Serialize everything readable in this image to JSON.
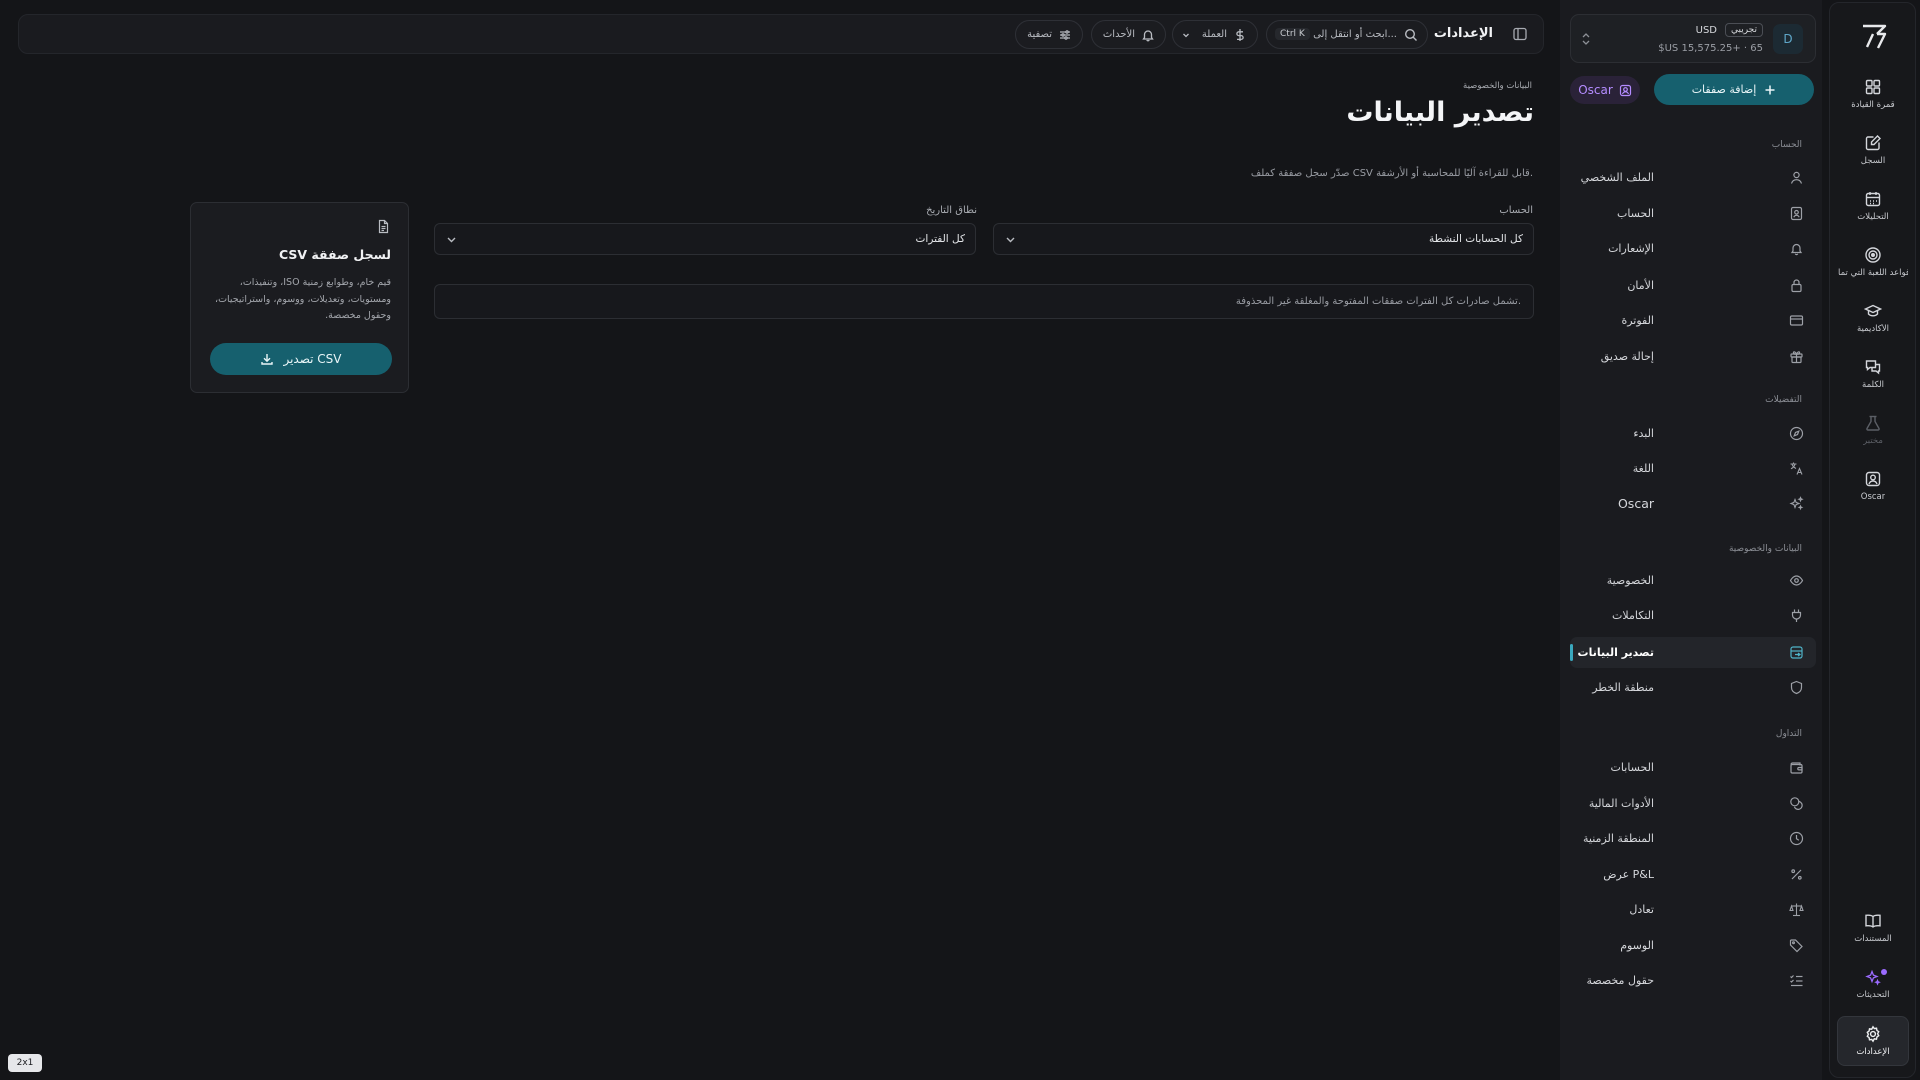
{
  "topbar": {
    "title": "الإعدادات",
    "search_placeholder": "ابحث أو انتقل إلى...",
    "search_shortcut": "Ctrl K",
    "currency_label": "العملة",
    "events_label": "الأحداث",
    "filter_label": "تصفية"
  },
  "page": {
    "breadcrumb": "البيانات والخصوصية",
    "title": "تصدير البيانات",
    "description": "صدّر سجل صفقة كملف CSV قابل للقراءة آليًا للمحاسبة أو الأرشفة.",
    "account_label": "الحساب",
    "account_value": "كل الحسابات النشطة",
    "range_label": "نطاق التاريخ",
    "range_value": "كل الفترات",
    "notice": "تشمل صادرات كل الفترات صفقات المفتوحة والمغلقة غير المحذوفة."
  },
  "card": {
    "title": "CSV لسجل صفقة",
    "description": "قيم خام، وطوابع زمنية ISO، وتنفيذات، ومستويات، وتعديلات، ووسوم، واستراتيجيات، وحقول مخصصة.",
    "button": "تصدير CSV"
  },
  "account_box": {
    "avatar": "D",
    "badge": "تجريبي",
    "currency": "USD",
    "balance": "$US 15,575.25+ · 65"
  },
  "sidebar": {
    "add_trade": "إضافة صفقات",
    "oscar_chip": "Oscar",
    "sections": [
      {
        "title": "الحساب",
        "items": [
          {
            "label": "الملف الشخصي",
            "icon": "user-icon"
          },
          {
            "label": "الحساب",
            "icon": "id-card-icon"
          },
          {
            "label": "الإشعارات",
            "icon": "bell-icon"
          },
          {
            "label": "الأمان",
            "icon": "lock-icon"
          },
          {
            "label": "الفوترة",
            "icon": "credit-card-icon"
          },
          {
            "label": "إحالة صديق",
            "icon": "gift-icon"
          }
        ]
      },
      {
        "title": "التفضيلات",
        "items": [
          {
            "label": "البدء",
            "icon": "compass-icon"
          },
          {
            "label": "اللغة",
            "icon": "translate-icon"
          },
          {
            "label": "Oscar",
            "icon": "sparkles-icon"
          }
        ]
      },
      {
        "title": "البيانات والخصوصية",
        "items": [
          {
            "label": "الخصوصية",
            "icon": "eye-icon"
          },
          {
            "label": "التكاملات",
            "icon": "plug-icon"
          },
          {
            "label": "تصدير البيانات",
            "icon": "database-export-icon"
          },
          {
            "label": "منطقة الخطر",
            "icon": "shield-icon"
          }
        ]
      },
      {
        "title": "التداول",
        "items": [
          {
            "label": "الحسابات",
            "icon": "wallet-icon"
          },
          {
            "label": "الأدوات المالية",
            "icon": "coins-icon"
          },
          {
            "label": "المنطقة الزمنية",
            "icon": "clock-icon"
          },
          {
            "label": "عرض P&L",
            "icon": "percent-icon"
          },
          {
            "label": "تعادل",
            "icon": "scale-icon"
          },
          {
            "label": "الوسوم",
            "icon": "tag-icon"
          },
          {
            "label": "حقول مخصصة",
            "icon": "list-check-icon"
          }
        ]
      }
    ]
  },
  "rail": {
    "items": [
      {
        "label": "قمرة القيادة",
        "icon": "dashboard-icon"
      },
      {
        "label": "السجل",
        "icon": "journal-icon"
      },
      {
        "label": "التحليلات",
        "icon": "calendar-icon"
      },
      {
        "label": "قواعد اللعبة التي تما...",
        "icon": "target-icon"
      },
      {
        "label": "الأكاديمية",
        "icon": "graduation-icon"
      },
      {
        "label": "الكلمة",
        "icon": "chat-icon"
      },
      {
        "label": "مختبر",
        "icon": "flask-icon"
      },
      {
        "label": "Oscar",
        "icon": "oscar-icon"
      }
    ],
    "bottom": [
      {
        "label": "المستندات",
        "icon": "book-icon"
      },
      {
        "label": "التحديثات",
        "icon": "sparkle-icon"
      },
      {
        "label": "الإعدادات",
        "icon": "settings-icon"
      }
    ]
  },
  "corner_badge": "2x1",
  "colors": {
    "accent": "#16606e",
    "active_indicator": "#3aa8be",
    "oscar": "#b48cff"
  }
}
